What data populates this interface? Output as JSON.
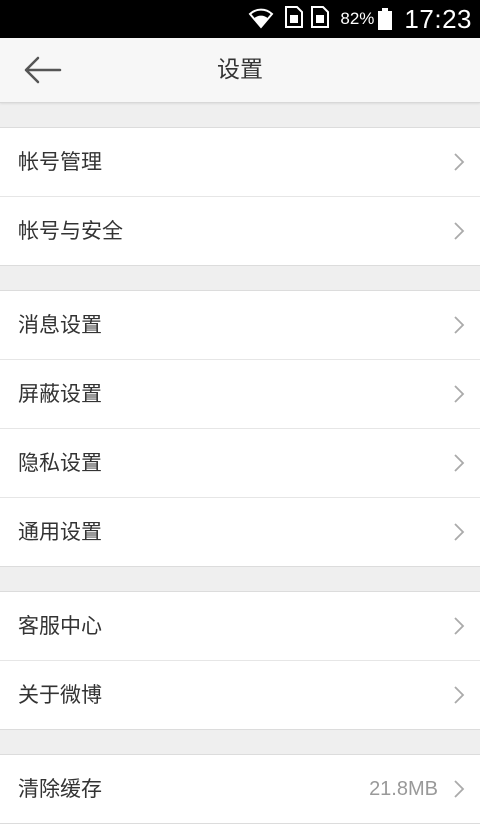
{
  "status_bar": {
    "battery_percent": "82%",
    "time": "17:23",
    "icons": [
      "wifi-icon",
      "sim-card-icon",
      "sim-card-icon",
      "battery-icon"
    ]
  },
  "header": {
    "title": "设置",
    "back_icon": "arrow-left-icon"
  },
  "groups": [
    {
      "items": [
        {
          "label": "帐号管理"
        },
        {
          "label": "帐号与安全"
        }
      ]
    },
    {
      "items": [
        {
          "label": "消息设置"
        },
        {
          "label": "屏蔽设置"
        },
        {
          "label": "隐私设置"
        },
        {
          "label": "通用设置"
        }
      ]
    },
    {
      "items": [
        {
          "label": "客服中心"
        },
        {
          "label": "关于微博"
        }
      ]
    },
    {
      "items": [
        {
          "label": "清除缓存",
          "value": "21.8MB"
        }
      ]
    }
  ],
  "colors": {
    "background": "#efefef",
    "row_background": "#ffffff",
    "text": "#333333",
    "chevron": "#aaaaaa",
    "status_bar": "#000000"
  }
}
